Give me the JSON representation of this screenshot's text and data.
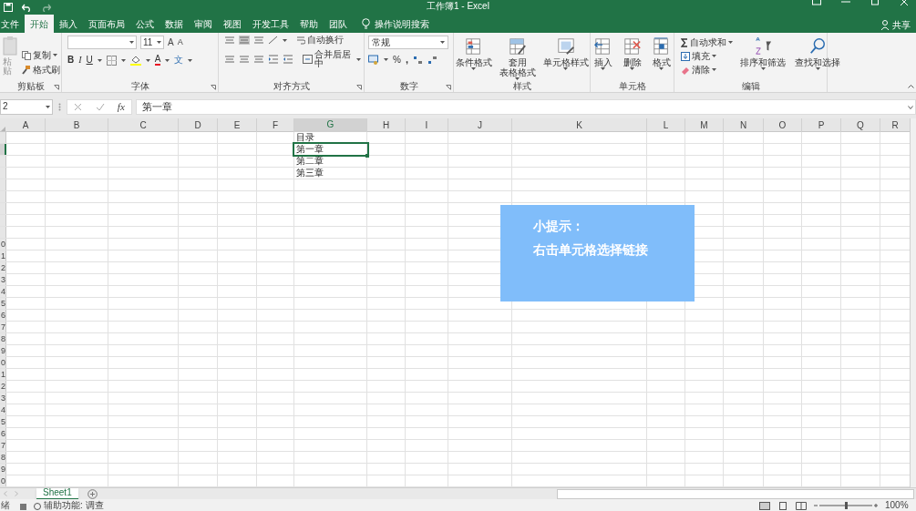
{
  "window": {
    "title": "工作簿1 - Excel",
    "share": "共享"
  },
  "tabs": [
    {
      "label": "文件",
      "selected": false
    },
    {
      "label": "开始",
      "selected": true
    },
    {
      "label": "插入",
      "selected": false
    },
    {
      "label": "页面布局",
      "selected": false
    },
    {
      "label": "公式",
      "selected": false
    },
    {
      "label": "数据",
      "selected": false
    },
    {
      "label": "审阅",
      "selected": false
    },
    {
      "label": "视图",
      "selected": false
    },
    {
      "label": "开发工具",
      "selected": false
    },
    {
      "label": "帮助",
      "selected": false
    },
    {
      "label": "团队",
      "selected": false
    }
  ],
  "tell_me": "操作说明搜索",
  "ribbon": [
    {
      "kind": "clipboard",
      "title": "剪贴板",
      "paste": "粘贴",
      "copy": "复制",
      "format_painter": "格式刷"
    },
    {
      "kind": "font",
      "title": "字体",
      "size": "11",
      "grow": "A",
      "shrink": "A",
      "bold": "B",
      "italic": "I",
      "underline": "U",
      "font_color": "A",
      "phonetic": "文"
    },
    {
      "kind": "alignment",
      "title": "对齐方式",
      "wrap": "自动换行",
      "merge": "合并后居中"
    },
    {
      "kind": "number",
      "title": "数字",
      "format": "常规",
      "percent": "%",
      "comma": ","
    },
    {
      "kind": "styles",
      "title": "样式",
      "items": [
        {
          "lines": [
            "条件格式"
          ]
        },
        {
          "lines": [
            "套用",
            "表格格式"
          ]
        },
        {
          "lines": [
            "单元格样式"
          ]
        }
      ]
    },
    {
      "kind": "cells",
      "title": "单元格",
      "items": [
        {
          "lines": [
            "插入"
          ]
        },
        {
          "lines": [
            "删除"
          ]
        },
        {
          "lines": [
            "格式"
          ]
        }
      ]
    },
    {
      "kind": "editing",
      "title": "编辑",
      "autosum": "自动求和",
      "fill": "填充",
      "clear": "清除",
      "sort": "排序和筛选",
      "find": "查找和选择"
    }
  ],
  "formula_bar": {
    "name_box": "2",
    "function_label": "fx",
    "formula": "第一章"
  },
  "columns": [
    {
      "label": "A",
      "selected": false
    },
    {
      "label": "B",
      "selected": false
    },
    {
      "label": "C",
      "selected": false
    },
    {
      "label": "D",
      "selected": false
    },
    {
      "label": "E",
      "selected": false
    },
    {
      "label": "F",
      "selected": false
    },
    {
      "label": "G",
      "selected": true
    },
    {
      "label": "H",
      "selected": false
    },
    {
      "label": "I",
      "selected": false
    },
    {
      "label": "J",
      "selected": false
    },
    {
      "label": "K",
      "selected": false
    },
    {
      "label": "L",
      "selected": false
    },
    {
      "label": "M",
      "selected": false
    },
    {
      "label": "N",
      "selected": false
    },
    {
      "label": "O",
      "selected": false
    },
    {
      "label": "P",
      "selected": false
    },
    {
      "label": "Q",
      "selected": false
    },
    {
      "label": "R",
      "selected": false
    }
  ],
  "rows": [
    {
      "selected": false,
      "g": "目录"
    },
    {
      "selected": true,
      "g": "第一章"
    },
    {
      "selected": false,
      "g": "第二章"
    },
    {
      "selected": false,
      "g": "第三章"
    },
    {
      "selected": false
    },
    {
      "selected": false
    },
    {
      "selected": false
    },
    {
      "selected": false
    },
    {
      "selected": false
    },
    {
      "selected": false,
      "header": "0"
    },
    {
      "selected": false,
      "header": "1"
    },
    {
      "selected": false,
      "header": "2"
    },
    {
      "selected": false,
      "header": "3"
    },
    {
      "selected": false,
      "header": "4"
    },
    {
      "selected": false,
      "header": "5"
    },
    {
      "selected": false,
      "header": "6"
    },
    {
      "selected": false,
      "header": "7"
    },
    {
      "selected": false,
      "header": "8"
    },
    {
      "selected": false,
      "header": "9"
    },
    {
      "selected": false,
      "header": "0"
    },
    {
      "selected": false,
      "header": "1"
    },
    {
      "selected": false,
      "header": "2"
    },
    {
      "selected": false,
      "header": "3"
    },
    {
      "selected": false,
      "header": "4"
    },
    {
      "selected": false,
      "header": "5"
    },
    {
      "selected": false,
      "header": "6"
    },
    {
      "selected": false,
      "header": "7"
    },
    {
      "selected": false,
      "header": "8"
    },
    {
      "selected": false,
      "header": "9"
    },
    {
      "selected": false,
      "header": "0"
    }
  ],
  "tip": {
    "title": "小提示：",
    "text": "右击单元格选择链接"
  },
  "sheet_tabs": [
    {
      "label": "Sheet1",
      "selected": true
    }
  ],
  "status_bar": {
    "ready": "绪",
    "accessibility": "辅助功能: 调查",
    "zoom": "100%"
  }
}
